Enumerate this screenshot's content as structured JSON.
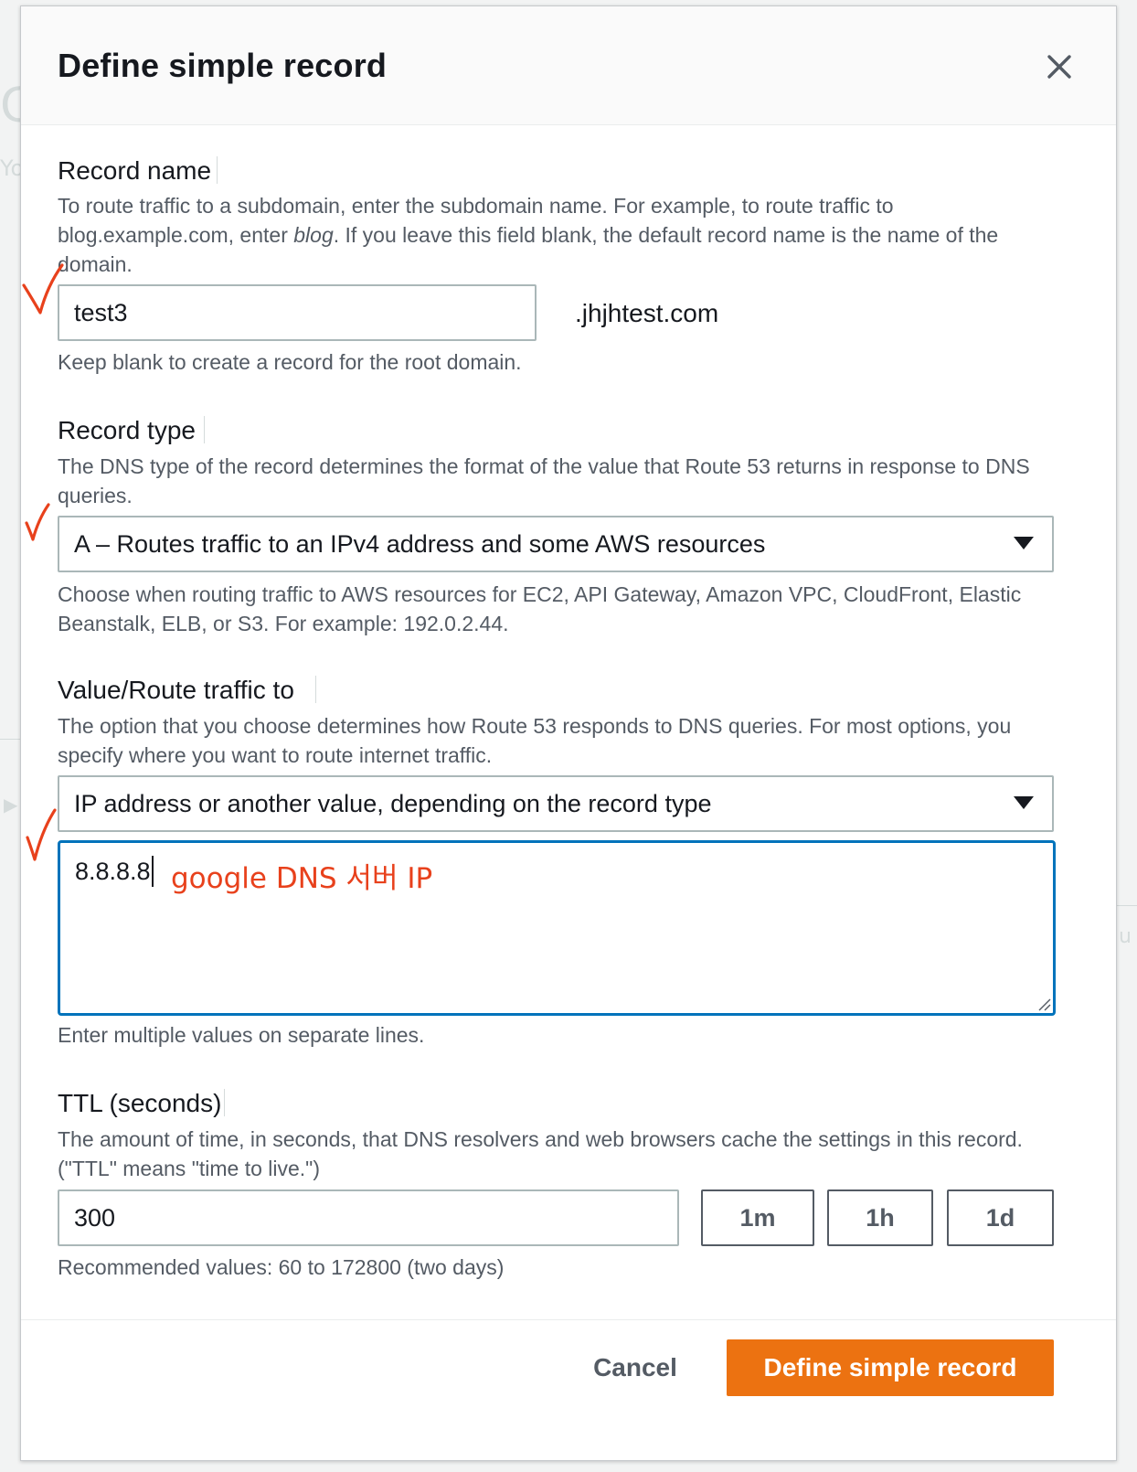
{
  "colors": {
    "primary_button": "#ec7211",
    "focus_border": "#0073bb",
    "annotation_red": "#e8411c",
    "check_red": "#e8411c"
  },
  "backdrop": {
    "letter_big": "C",
    "letter_small": "Yo",
    "letter_mid": "u"
  },
  "modal": {
    "title": "Define simple record",
    "close_icon": "close-icon"
  },
  "record_name": {
    "label": "Record name",
    "description": "To route traffic to a subdomain, enter the subdomain name. For example, to route traffic to blog.example.com, enter blog. If you leave this field blank, the default record name is the name of the domain.",
    "desc_before": "To route traffic to a subdomain, enter the subdomain name. For example, to route traffic to blog.example.com, enter ",
    "desc_italic": "blog",
    "desc_after": ". If you leave this field blank, the default record name is the name of the domain.",
    "value": "test3",
    "suffix": ".jhjhtest.com",
    "constraint": "Keep blank to create a record for the root domain."
  },
  "record_type": {
    "label": "Record type",
    "description": "The DNS type of the record determines the format of the value that Route 53 returns in response to DNS queries.",
    "selected": "A – Routes traffic to an IPv4 address and some AWS resources",
    "constraint": "Choose when routing traffic to AWS resources for EC2, API Gateway, Amazon VPC, CloudFront, Elastic Beanstalk, ELB, or S3. For example: 192.0.2.44."
  },
  "value_route": {
    "label": "Value/Route traffic to",
    "description": "The option that you choose determines how Route 53 responds to DNS queries. For most options, you specify where you want to route internet traffic.",
    "selected": "IP address or another value, depending on the record type",
    "value": "8.8.8.8",
    "annotation": "google DNS 서버 IP",
    "constraint": "Enter multiple values on separate lines."
  },
  "ttl": {
    "label": "TTL (seconds)",
    "description": "The amount of time, in seconds, that DNS resolvers and web browsers cache the settings in this record. (\"TTL\" means \"time to live.\")",
    "value": "300",
    "buttons": [
      "1m",
      "1h",
      "1d"
    ],
    "constraint": "Recommended values: 60 to 172800 (two days)"
  },
  "footer": {
    "cancel_label": "Cancel",
    "submit_label": "Define simple record"
  }
}
